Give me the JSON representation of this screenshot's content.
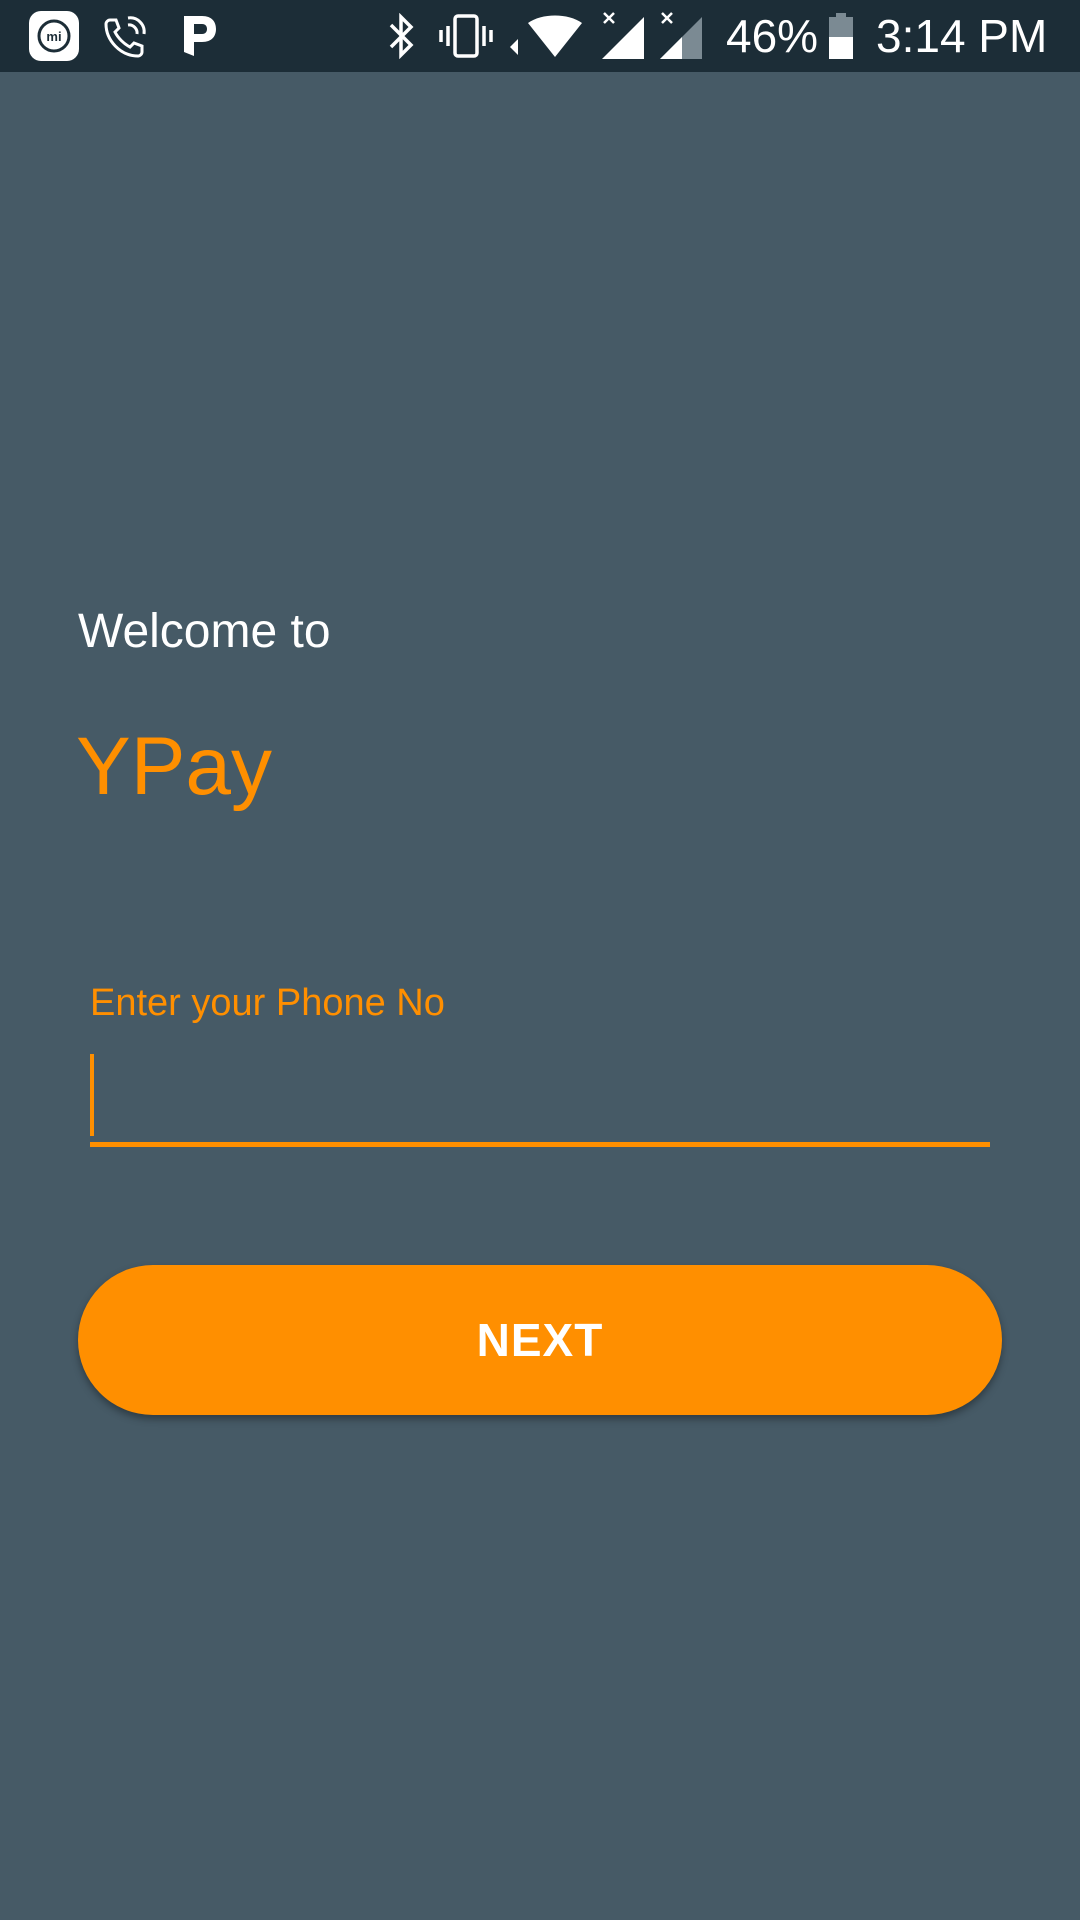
{
  "status_bar": {
    "battery_percent": "46%",
    "time": "3:14 PM",
    "battery_level": 0.46,
    "icons": [
      "mi-icon",
      "wifi-call-icon",
      "parking-app-icon",
      "bluetooth-icon",
      "vibrate-icon",
      "wifi-icon",
      "signal-icon",
      "signal-icon",
      "battery-icon"
    ]
  },
  "main": {
    "welcome_text": "Welcome to",
    "app_name": "YPay",
    "phone_field": {
      "label": "Enter your Phone No",
      "value": ""
    },
    "next_button_label": "NEXT"
  },
  "colors": {
    "background": "#465a66",
    "status_bar": "#1c2d37",
    "accent": "#ff8f00",
    "text": "#ffffff"
  }
}
